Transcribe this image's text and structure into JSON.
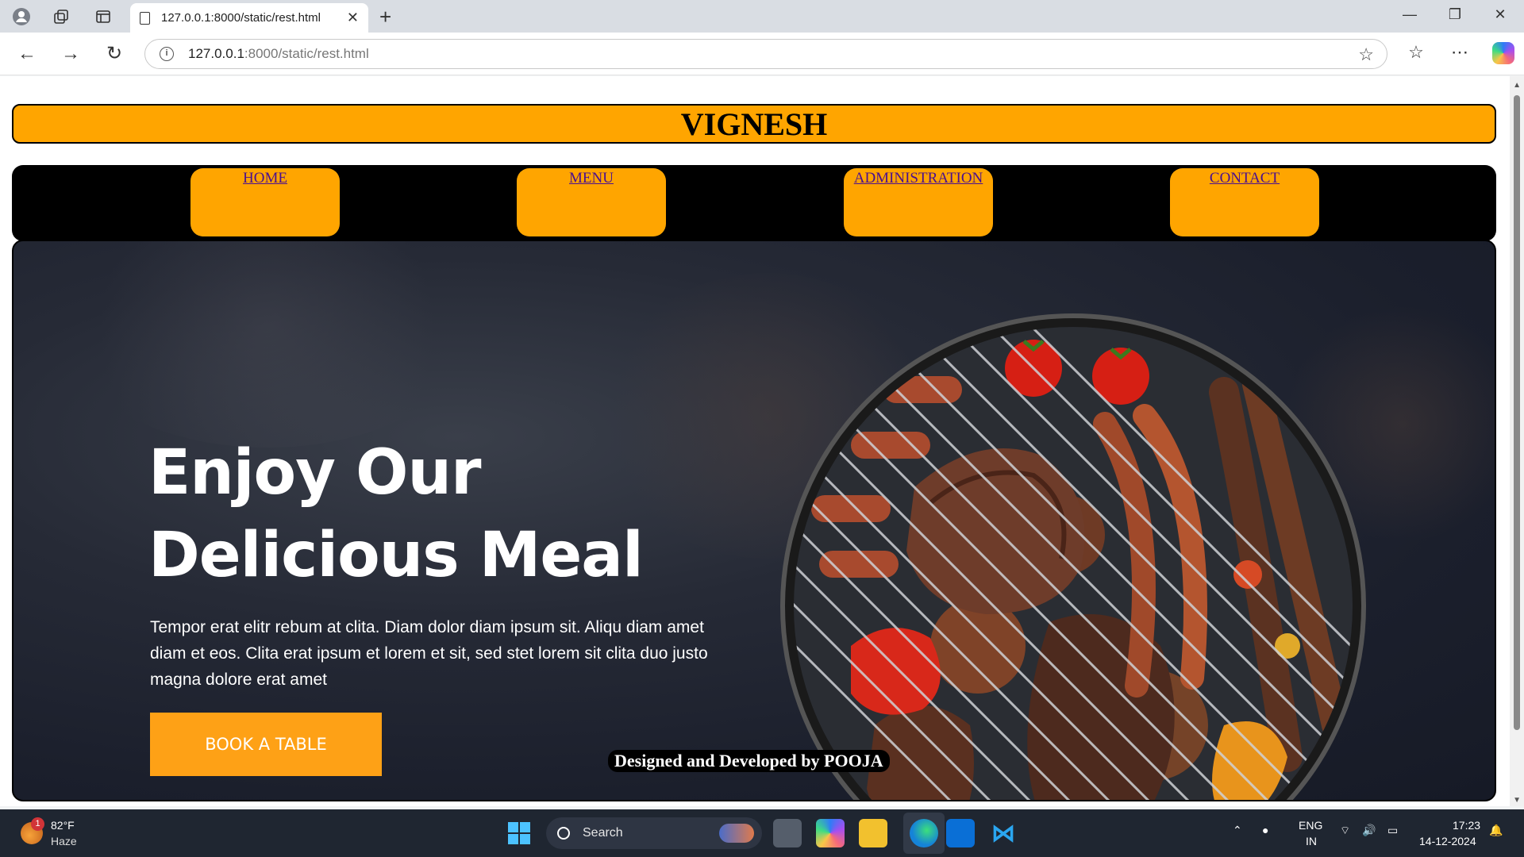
{
  "browser": {
    "tab_title": "127.0.0.1:8000/static/rest.html",
    "url_host": "127.0.0.1",
    "url_rest": ":8000/static/rest.html"
  },
  "site": {
    "title": "VIGNESH",
    "nav": [
      "HOME",
      "MENU",
      "ADMINISTRATION",
      "CONTACT"
    ],
    "hero": {
      "heading_line1": "Enjoy Our",
      "heading_line2": "Delicious Meal",
      "text": "Tempor erat elitr rebum at clita. Diam dolor diam ipsum sit. Aliqu diam amet diam et eos. Clita erat ipsum et lorem et sit, sed stet lorem sit clita duo justo magna dolore erat amet",
      "button": "BOOK A TABLE"
    },
    "credit": "Designed and Developed by POOJA"
  },
  "taskbar": {
    "weather_badge": "1",
    "temperature": "82°F",
    "condition": "Haze",
    "search_label": "Search",
    "lang_line1": "ENG",
    "lang_line2": "IN",
    "time": "17:23",
    "date": "14-12-2024"
  },
  "colors": {
    "accent": "#ffa500",
    "button": "#fea116",
    "nav_bg": "#000000",
    "hero_bg": "#1b1f2c"
  }
}
